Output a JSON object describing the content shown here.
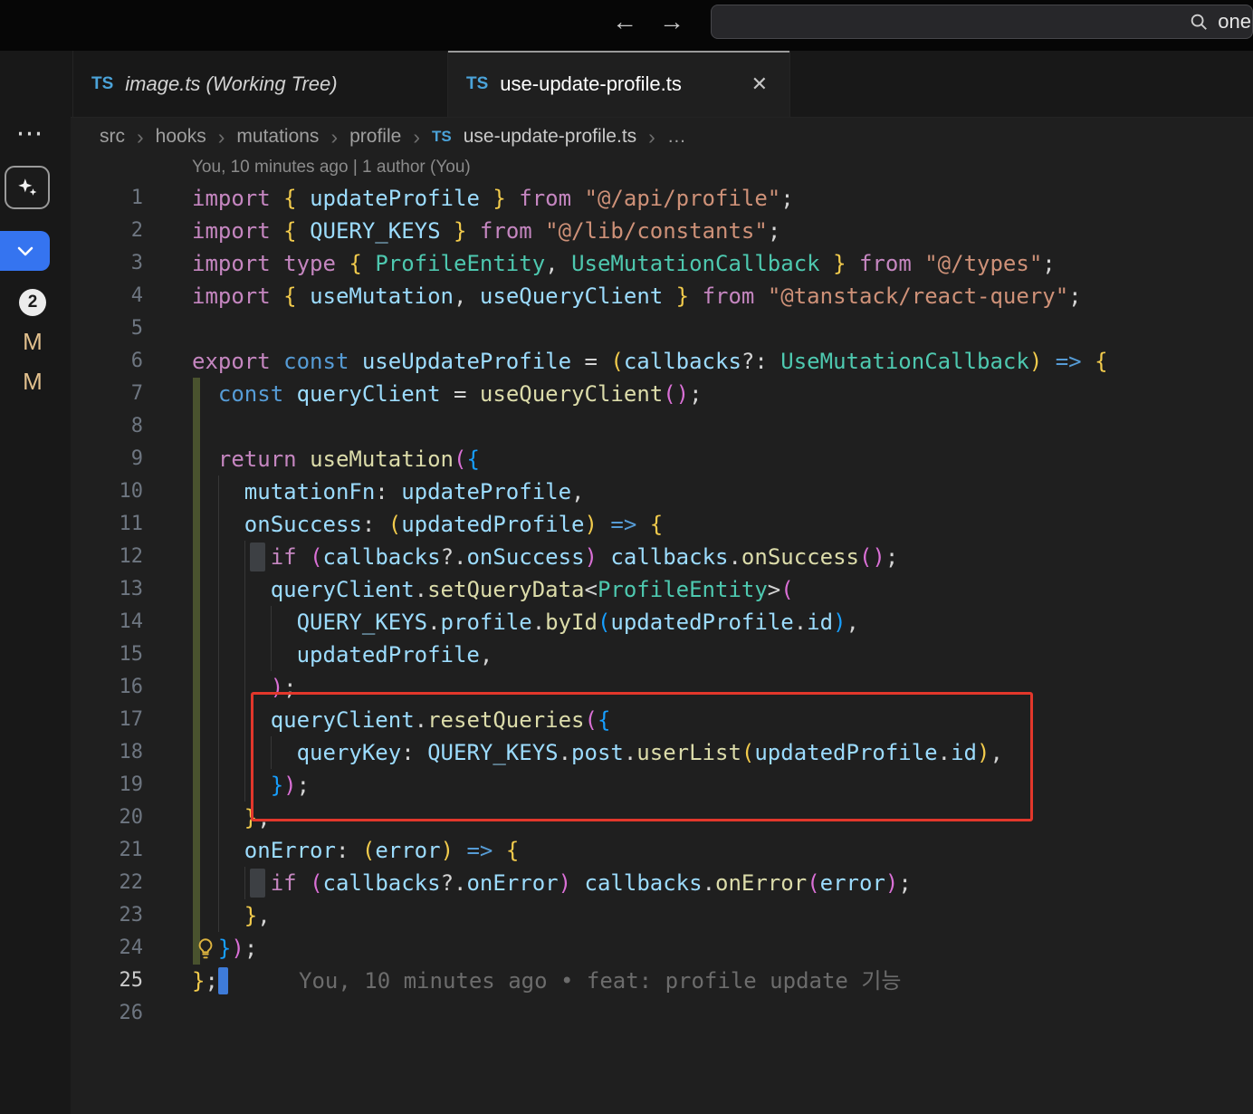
{
  "titlebar": {
    "back_icon": "←",
    "forward_icon": "→",
    "search_text": "one"
  },
  "activity_rail": {
    "overflow_icon": "⋯",
    "badge": "2",
    "decorations": [
      "M",
      "M"
    ]
  },
  "tabs": [
    {
      "icon": "TS",
      "label": "image.ts (Working Tree)",
      "active": false
    },
    {
      "icon": "TS",
      "label": "use-update-profile.ts",
      "active": true,
      "close_icon": "✕"
    }
  ],
  "breadcrumb": {
    "separator": "›",
    "items": [
      "src",
      "hooks",
      "mutations",
      "profile"
    ],
    "file_icon": "TS",
    "file": "use-update-profile.ts",
    "overflow": "…"
  },
  "colors": {
    "annotation_red": "#E2372B",
    "git_modified": "#E2C08D",
    "accent_blue": "#3574F0",
    "editor_background": "#1f1f1f"
  },
  "editor": {
    "codelens": "You, 10 minutes ago | 1 author (You)",
    "inline_blame": "You, 10 minutes ago • feat: profile update 기능",
    "lines": [
      {
        "n": 1,
        "guides": [],
        "tokens": [
          [
            "kw",
            "import"
          ],
          [
            "pun",
            " "
          ],
          [
            "b1",
            "{"
          ],
          [
            "pun",
            " "
          ],
          [
            "var",
            "updateProfile"
          ],
          [
            "pun",
            " "
          ],
          [
            "b1",
            "}"
          ],
          [
            "pun",
            " "
          ],
          [
            "kw",
            "from"
          ],
          [
            "pun",
            " "
          ],
          [
            "str",
            "\"@/api/profile\""
          ],
          [
            "pun",
            ";"
          ]
        ]
      },
      {
        "n": 2,
        "guides": [],
        "tokens": [
          [
            "kw",
            "import"
          ],
          [
            "pun",
            " "
          ],
          [
            "b1",
            "{"
          ],
          [
            "pun",
            " "
          ],
          [
            "var",
            "QUERY_KEYS"
          ],
          [
            "pun",
            " "
          ],
          [
            "b1",
            "}"
          ],
          [
            "pun",
            " "
          ],
          [
            "kw",
            "from"
          ],
          [
            "pun",
            " "
          ],
          [
            "str",
            "\"@/lib/constants\""
          ],
          [
            "pun",
            ";"
          ]
        ]
      },
      {
        "n": 3,
        "guides": [],
        "tokens": [
          [
            "kw",
            "import"
          ],
          [
            "pun",
            " "
          ],
          [
            "kw",
            "type"
          ],
          [
            "pun",
            " "
          ],
          [
            "b1",
            "{"
          ],
          [
            "pun",
            " "
          ],
          [
            "type",
            "ProfileEntity"
          ],
          [
            "pun",
            ", "
          ],
          [
            "type",
            "UseMutationCallback"
          ],
          [
            "pun",
            " "
          ],
          [
            "b1",
            "}"
          ],
          [
            "pun",
            " "
          ],
          [
            "kw",
            "from"
          ],
          [
            "pun",
            " "
          ],
          [
            "str",
            "\"@/types\""
          ],
          [
            "pun",
            ";"
          ]
        ]
      },
      {
        "n": 4,
        "guides": [],
        "tokens": [
          [
            "kw",
            "import"
          ],
          [
            "pun",
            " "
          ],
          [
            "b1",
            "{"
          ],
          [
            "pun",
            " "
          ],
          [
            "var",
            "useMutation"
          ],
          [
            "pun",
            ", "
          ],
          [
            "var",
            "useQueryClient"
          ],
          [
            "pun",
            " "
          ],
          [
            "b1",
            "}"
          ],
          [
            "pun",
            " "
          ],
          [
            "kw",
            "from"
          ],
          [
            "pun",
            " "
          ],
          [
            "str",
            "\"@tanstack/react-query\""
          ],
          [
            "pun",
            ";"
          ]
        ]
      },
      {
        "n": 5,
        "guides": [],
        "tokens": []
      },
      {
        "n": 6,
        "guides": [],
        "tokens": [
          [
            "kw",
            "export"
          ],
          [
            "pun",
            " "
          ],
          [
            "kw2",
            "const"
          ],
          [
            "pun",
            " "
          ],
          [
            "var",
            "useUpdateProfile"
          ],
          [
            "pun",
            " = "
          ],
          [
            "b1",
            "("
          ],
          [
            "var",
            "callbacks"
          ],
          [
            "pun",
            "?: "
          ],
          [
            "type",
            "UseMutationCallback"
          ],
          [
            "b1",
            ")"
          ],
          [
            "pun",
            " "
          ],
          [
            "kw2",
            "=>"
          ],
          [
            "pun",
            " "
          ],
          [
            "b1",
            "{"
          ]
        ]
      },
      {
        "n": 7,
        "guides": [],
        "tokens": [
          [
            "pun",
            "  "
          ],
          [
            "kw2",
            "const"
          ],
          [
            "pun",
            " "
          ],
          [
            "var",
            "queryClient"
          ],
          [
            "pun",
            " = "
          ],
          [
            "fn",
            "useQueryClient"
          ],
          [
            "b2",
            "()"
          ],
          [
            "pun",
            ";"
          ]
        ]
      },
      {
        "n": 8,
        "guides": [],
        "tokens": []
      },
      {
        "n": 9,
        "guides": [],
        "tokens": [
          [
            "pun",
            "  "
          ],
          [
            "kw",
            "return"
          ],
          [
            "pun",
            " "
          ],
          [
            "fn",
            "useMutation"
          ],
          [
            "b2",
            "("
          ],
          [
            "b3",
            "{"
          ]
        ]
      },
      {
        "n": 10,
        "guides": [
          2
        ],
        "tokens": [
          [
            "pun",
            "    "
          ],
          [
            "var",
            "mutationFn"
          ],
          [
            "pun",
            ": "
          ],
          [
            "var",
            "updateProfile"
          ],
          [
            "pun",
            ","
          ]
        ]
      },
      {
        "n": 11,
        "guides": [
          2
        ],
        "tokens": [
          [
            "pun",
            "    "
          ],
          [
            "var",
            "onSuccess"
          ],
          [
            "pun",
            ": "
          ],
          [
            "b1",
            "("
          ],
          [
            "var",
            "updatedProfile"
          ],
          [
            "b1",
            ")"
          ],
          [
            "pun",
            " "
          ],
          [
            "kw2",
            "=>"
          ],
          [
            "pun",
            " "
          ],
          [
            "b1",
            "{"
          ]
        ]
      },
      {
        "n": 12,
        "guides": [
          2,
          4
        ],
        "block": true,
        "tokens": [
          [
            "pun",
            "      "
          ],
          [
            "kw",
            "if"
          ],
          [
            "pun",
            " "
          ],
          [
            "b2",
            "("
          ],
          [
            "var",
            "callbacks"
          ],
          [
            "pun",
            "?."
          ],
          [
            "var",
            "onSuccess"
          ],
          [
            "b2",
            ")"
          ],
          [
            "pun",
            " "
          ],
          [
            "var",
            "callbacks"
          ],
          [
            "pun",
            "."
          ],
          [
            "fn",
            "onSuccess"
          ],
          [
            "b2",
            "()"
          ],
          [
            "pun",
            ";"
          ]
        ]
      },
      {
        "n": 13,
        "guides": [
          2,
          4
        ],
        "tokens": [
          [
            "pun",
            "      "
          ],
          [
            "var",
            "queryClient"
          ],
          [
            "pun",
            "."
          ],
          [
            "fn",
            "setQueryData"
          ],
          [
            "pun",
            "<"
          ],
          [
            "type",
            "ProfileEntity"
          ],
          [
            "pun",
            ">"
          ],
          [
            "b2",
            "("
          ]
        ]
      },
      {
        "n": 14,
        "guides": [
          2,
          4,
          6
        ],
        "tokens": [
          [
            "pun",
            "        "
          ],
          [
            "var",
            "QUERY_KEYS"
          ],
          [
            "pun",
            "."
          ],
          [
            "var",
            "profile"
          ],
          [
            "pun",
            "."
          ],
          [
            "fn",
            "byId"
          ],
          [
            "b3",
            "("
          ],
          [
            "var",
            "updatedProfile"
          ],
          [
            "pun",
            "."
          ],
          [
            "var",
            "id"
          ],
          [
            "b3",
            ")"
          ],
          [
            "pun",
            ","
          ]
        ]
      },
      {
        "n": 15,
        "guides": [
          2,
          4,
          6
        ],
        "tokens": [
          [
            "pun",
            "        "
          ],
          [
            "var",
            "updatedProfile"
          ],
          [
            "pun",
            ","
          ]
        ]
      },
      {
        "n": 16,
        "guides": [
          2,
          4
        ],
        "tokens": [
          [
            "pun",
            "      "
          ],
          [
            "b2",
            ")"
          ],
          [
            "pun",
            ";"
          ]
        ]
      },
      {
        "n": 17,
        "guides": [
          2,
          4
        ],
        "tokens": [
          [
            "pun",
            "      "
          ],
          [
            "var",
            "queryClient"
          ],
          [
            "pun",
            "."
          ],
          [
            "fn",
            "resetQueries"
          ],
          [
            "b2",
            "("
          ],
          [
            "b3",
            "{"
          ]
        ]
      },
      {
        "n": 18,
        "guides": [
          2,
          4,
          6
        ],
        "tokens": [
          [
            "pun",
            "        "
          ],
          [
            "var",
            "queryKey"
          ],
          [
            "pun",
            ": "
          ],
          [
            "var",
            "QUERY_KEYS"
          ],
          [
            "pun",
            "."
          ],
          [
            "var",
            "post"
          ],
          [
            "pun",
            "."
          ],
          [
            "fn",
            "userList"
          ],
          [
            "b1",
            "("
          ],
          [
            "var",
            "updatedProfile"
          ],
          [
            "pun",
            "."
          ],
          [
            "var",
            "id"
          ],
          [
            "b1",
            ")"
          ],
          [
            "pun",
            ","
          ]
        ]
      },
      {
        "n": 19,
        "guides": [
          2,
          4
        ],
        "tokens": [
          [
            "pun",
            "      "
          ],
          [
            "b3",
            "}"
          ],
          [
            "b2",
            ")"
          ],
          [
            "pun",
            ";"
          ]
        ]
      },
      {
        "n": 20,
        "guides": [
          2
        ],
        "tokens": [
          [
            "pun",
            "    "
          ],
          [
            "b1",
            "}"
          ],
          [
            "pun",
            ","
          ]
        ]
      },
      {
        "n": 21,
        "guides": [
          2
        ],
        "tokens": [
          [
            "pun",
            "    "
          ],
          [
            "var",
            "onError"
          ],
          [
            "pun",
            ": "
          ],
          [
            "b1",
            "("
          ],
          [
            "var",
            "error"
          ],
          [
            "b1",
            ")"
          ],
          [
            "pun",
            " "
          ],
          [
            "kw2",
            "=>"
          ],
          [
            "pun",
            " "
          ],
          [
            "b1",
            "{"
          ]
        ]
      },
      {
        "n": 22,
        "guides": [
          2,
          4
        ],
        "block": true,
        "tokens": [
          [
            "pun",
            "      "
          ],
          [
            "kw",
            "if"
          ],
          [
            "pun",
            " "
          ],
          [
            "b2",
            "("
          ],
          [
            "var",
            "callbacks"
          ],
          [
            "pun",
            "?."
          ],
          [
            "var",
            "onError"
          ],
          [
            "b2",
            ")"
          ],
          [
            "pun",
            " "
          ],
          [
            "var",
            "callbacks"
          ],
          [
            "pun",
            "."
          ],
          [
            "fn",
            "onError"
          ],
          [
            "b2",
            "("
          ],
          [
            "var",
            "error"
          ],
          [
            "b2",
            ")"
          ],
          [
            "pun",
            ";"
          ]
        ]
      },
      {
        "n": 23,
        "guides": [
          2
        ],
        "tokens": [
          [
            "pun",
            "    "
          ],
          [
            "b1",
            "}"
          ],
          [
            "pun",
            ","
          ]
        ]
      },
      {
        "n": 24,
        "guides": [],
        "bulb": true,
        "tokens": [
          [
            "pun",
            "  "
          ],
          [
            "b3",
            "}"
          ],
          [
            "b2",
            ")"
          ],
          [
            "pun",
            ";"
          ]
        ]
      },
      {
        "n": 25,
        "guides": [],
        "active": true,
        "cursor": true,
        "has_inline_blame": true,
        "tokens": [
          [
            "b1",
            "}"
          ],
          [
            "pun",
            ";"
          ]
        ]
      },
      {
        "n": 26,
        "guides": [],
        "tokens": []
      }
    ]
  }
}
